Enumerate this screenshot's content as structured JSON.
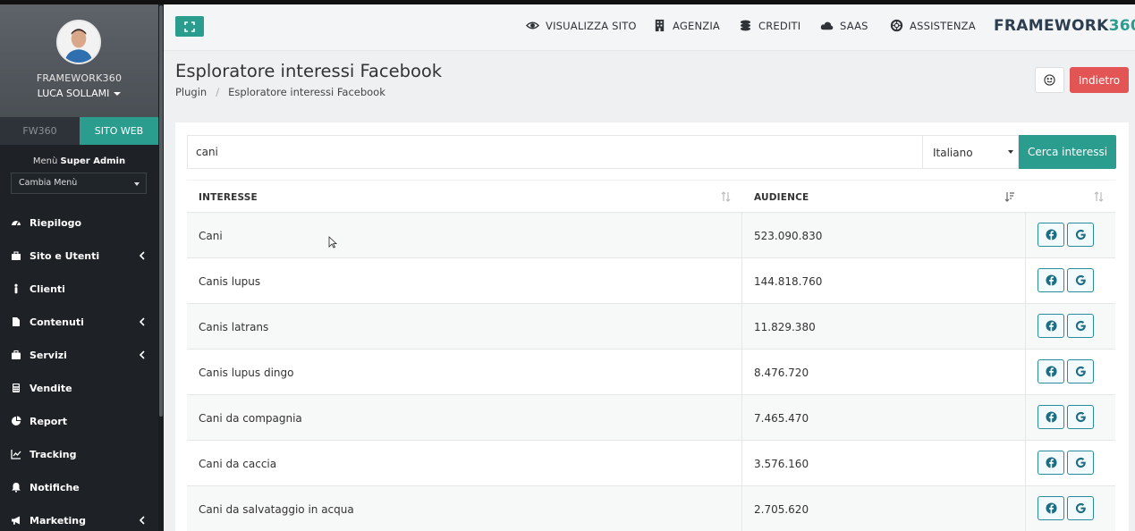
{
  "sidebar": {
    "profile_line1": "FRAMEWORK360",
    "profile_line2": "LUCA SOLLAMI",
    "switch_fw": "FW360",
    "switch_web": "SITO WEB",
    "menu_title_prefix": "Menù",
    "menu_title_bold": "Super Admin",
    "menu_select": "Cambia Menù",
    "items": [
      {
        "label": "Riepilogo",
        "icon": "dashboard-icon",
        "submenu": false
      },
      {
        "label": "Sito e Utenti",
        "icon": "briefcase-icon",
        "submenu": true
      },
      {
        "label": "Clienti",
        "icon": "person-icon",
        "submenu": false
      },
      {
        "label": "Contenuti",
        "icon": "file-icon",
        "submenu": true
      },
      {
        "label": "Servizi",
        "icon": "suitcase-icon",
        "submenu": true
      },
      {
        "label": "Vendite",
        "icon": "calculator-icon",
        "submenu": false
      },
      {
        "label": "Report",
        "icon": "pie-chart-icon",
        "submenu": false
      },
      {
        "label": "Tracking",
        "icon": "line-chart-icon",
        "submenu": false
      },
      {
        "label": "Notifiche",
        "icon": "bell-icon",
        "submenu": false
      },
      {
        "label": "Marketing",
        "icon": "megaphone-icon",
        "submenu": true
      }
    ]
  },
  "header": {
    "nav": [
      {
        "label": "VISUALIZZA SITO",
        "icon": "eye-icon"
      },
      {
        "label": "AGENZIA",
        "icon": "building-icon"
      },
      {
        "label": "CREDITI",
        "icon": "coins-icon"
      },
      {
        "label": "SAAS",
        "icon": "cloud-icon"
      },
      {
        "label": "ASSISTENZA",
        "icon": "lifebuoy-icon"
      }
    ],
    "brand_main": "FRAMEWORK",
    "brand_accent": "360"
  },
  "page": {
    "title": "Esploratore interessi Facebook",
    "breadcrumb": [
      "Plugin",
      "Esploratore interessi Facebook"
    ],
    "back_label": "Indietro"
  },
  "search": {
    "value": "cani",
    "language": "Italiano",
    "button_label": "Cerca interessi"
  },
  "table": {
    "columns": [
      "INTERESSE",
      "AUDIENCE"
    ],
    "rows": [
      {
        "interest": "Cani",
        "audience": "523.090.830"
      },
      {
        "interest": "Canis lupus",
        "audience": "144.818.760"
      },
      {
        "interest": "Canis latrans",
        "audience": "11.829.380"
      },
      {
        "interest": "Canis lupus dingo",
        "audience": "8.476.720"
      },
      {
        "interest": "Cani da compagnia",
        "audience": "7.465.470"
      },
      {
        "interest": "Cani da caccia",
        "audience": "3.576.160"
      },
      {
        "interest": "Cani da salvataggio in acqua",
        "audience": "2.705.620"
      }
    ]
  },
  "colors": {
    "accent": "#2a9d8f",
    "danger": "#e35454",
    "sidebar": "#1e2226"
  }
}
